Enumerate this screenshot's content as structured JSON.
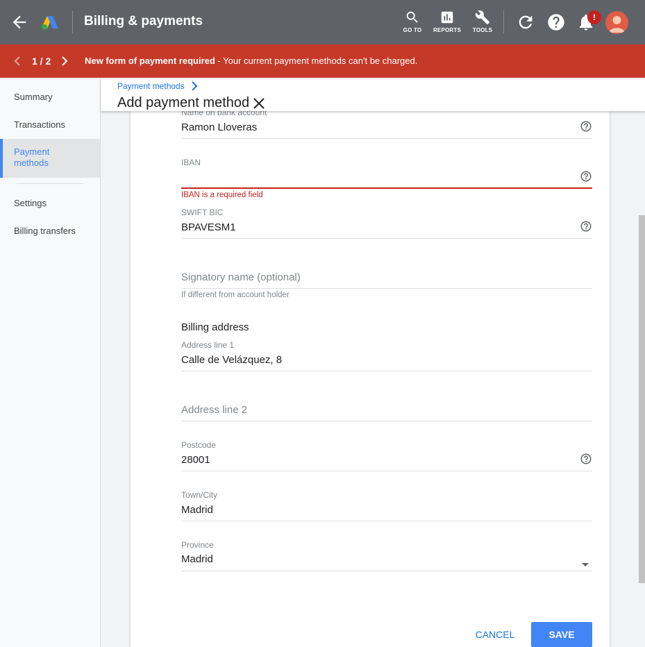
{
  "app": {
    "title": "Billing & payments"
  },
  "topnav": {
    "goto_label": "GO TO",
    "reports_label": "REPORTS",
    "tools_label": "TOOLS",
    "notification_badge": "!"
  },
  "alert": {
    "count": "1 / 2",
    "title": "New form of payment required",
    "message": " - Your current payment methods can't be charged.",
    "color": "#c53929"
  },
  "sidebar": {
    "items": [
      {
        "label": "Summary"
      },
      {
        "label": "Transactions"
      },
      {
        "label": "Payment methods",
        "active": true
      },
      {
        "label": "Settings"
      },
      {
        "label": "Billing transfers"
      }
    ]
  },
  "header": {
    "breadcrumb": "Payment methods",
    "title": "Add payment method"
  },
  "form": {
    "account_name": {
      "label": "Name on bank account",
      "value": "Ramon Lloveras"
    },
    "iban": {
      "label": "IBAN",
      "value": "",
      "error": "IBAN is a required field"
    },
    "swift": {
      "label": "SWIFT BIC",
      "value": "BPAVESM1"
    },
    "signatory": {
      "placeholder": "Signatory name (optional)",
      "hint": "If different from account holder"
    },
    "billing_address_title": "Billing address",
    "address1": {
      "label": "Address line 1",
      "value": "Calle de Velázquez, 8"
    },
    "address2": {
      "placeholder": "Address line 2"
    },
    "postcode": {
      "label": "Postcode",
      "value": "28001"
    },
    "city": {
      "label": "Town/City",
      "value": "Madrid"
    },
    "province": {
      "label": "Province",
      "value": "Madrid"
    }
  },
  "actions": {
    "cancel": "CANCEL",
    "save": "SAVE"
  },
  "colors": {
    "accent": "#4285f4",
    "error": "#c5221f",
    "topbar": "#5f6368"
  }
}
